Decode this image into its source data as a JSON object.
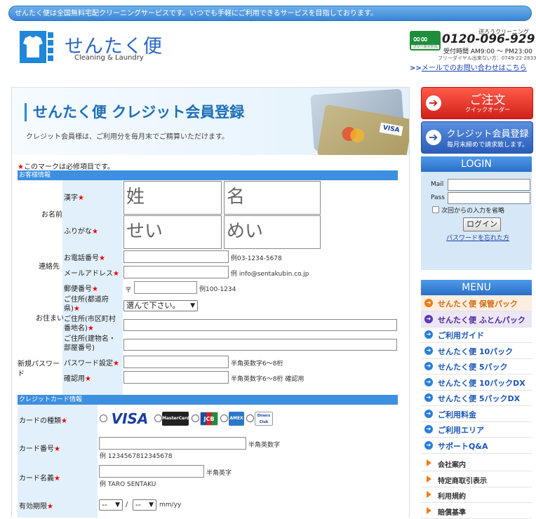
{
  "top_bar": {
    "text": "せんたく便は全国無料宅配クリーニングサービスです。いつでも手軽にご利用できるサービスを目指しております。"
  },
  "logo": {
    "jp": "せんたく便",
    "en": "Cleaning & Laundry"
  },
  "tel": {
    "note": "送ろうクリーニング",
    "number": "0120-096-929",
    "hours": "受付時間 AM9:00 〜 PM23:00",
    "free_note": "フリーダイヤル出来ない方：0749-22-2833",
    "freedial_badge": "フリーダイヤル",
    "mail_prefix": ">>",
    "mail_link": "メールでのお問い合わせはこちら"
  },
  "banner": {
    "title": "せんたく便 クレジット会員登録",
    "subtitle": "クレジット会員様は、ご利用分を毎月末でご精算いただけます。"
  },
  "form": {
    "required_note": "このマークは必修項目です。",
    "star": "★",
    "section_customer": "お客様情報",
    "section_card": "クレジットカード情報",
    "name_group": "お名前",
    "kanji_label": "漢字",
    "kana_label": "ふりがな",
    "sei_placeholder": "姓",
    "mei_placeholder": "名",
    "sei_kana_placeholder": "せい",
    "mei_kana_placeholder": "めい",
    "contact_group": "連絡先",
    "phone_label": "お電話番号",
    "phone_hint": "例03-1234-5678",
    "email_label": "メールアドレス",
    "email_hint": "例 info@sentakubin.co.jp",
    "address_group": "お住まい",
    "zip_label": "郵便番号",
    "zip_prefix": "〒",
    "zip_hint": "例100-1234",
    "pref_label": "ご住所(都道府県)",
    "pref_select": "選んで下さい。",
    "city_label": "ご住所(市区町村番地名)",
    "building_label": "ご住所(建物名・部屋番号)",
    "new_pw_group": "新規パスワード",
    "pw_label": "パスワード設定",
    "pw_hint": "半角英数字6〜8桁",
    "pw_confirm_label": "確認用",
    "pw_confirm_hint": "半角英数字6〜8桁 確認用",
    "card_type_label": "カードの種類",
    "card_brands": [
      "VISA",
      "MasterCard",
      "JCB",
      "AMEX",
      "Diners Club"
    ],
    "card_number_label": "カード番号",
    "card_number_hint": "半角英数字",
    "card_number_example": "例 1234567812345678",
    "card_name_label": "カード名義",
    "card_name_hint": "半角英字",
    "card_name_example": "例 TARO SENTAKU",
    "expiry_label": "有効期限",
    "expiry_month": "--",
    "expiry_year": "--",
    "expiry_sep": "/",
    "expiry_format": "mm/yy"
  },
  "sidebar": {
    "order_title": "ご注文",
    "order_sub": "クイックオーダー",
    "credit_title": "クレジット会員登録",
    "credit_sub": "毎月末締めで請求致します。",
    "login_head": "LOGIN",
    "mail_label": "Mail",
    "pass_label": "Pass",
    "remember": "次回からの入力を省略",
    "login_button": "ログイン",
    "forgot": "パスワードを忘れた方",
    "menu_head": "MENU",
    "menu_items": [
      "せんたく便 保管パック",
      "せんたく便 ふとんパック",
      "ご利用ガイド",
      "せんたく便 10パック",
      "せんたく便 5パック",
      "せんたく便 10パックDX",
      "せんたく便 5パックDX",
      "ご利用料金",
      "ご利用エリア",
      "サポートQ&A"
    ],
    "sub_items": [
      "会社案内",
      "特定商取引表示",
      "利用規約",
      "賠償基準"
    ]
  },
  "colors": {
    "accent_blue": "#3d8fe0",
    "required_red": "#e00000",
    "order_red": "#d0201a",
    "menu_orange": "#ef7c1a"
  }
}
